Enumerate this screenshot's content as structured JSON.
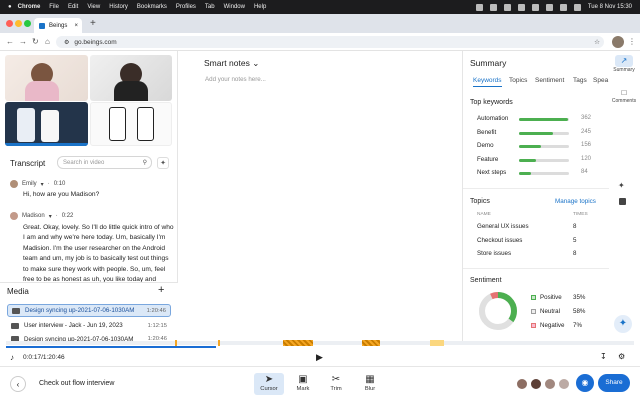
{
  "menubar": {
    "app": "Chrome",
    "items": [
      "File",
      "Edit",
      "View",
      "History",
      "Bookmarks",
      "Profiles",
      "Tab",
      "Window",
      "Help"
    ],
    "clock": "Tue 8 Nov 15:30"
  },
  "browser": {
    "tab_title": "Beings",
    "url": "go.beings.com"
  },
  "transcript": {
    "title": "Transcript",
    "search_placeholder": "Search in video",
    "entries": [
      {
        "speaker": "Emily",
        "time": "0:10",
        "lines": [
          "Hi, how are you Madison?"
        ]
      },
      {
        "speaker": "Madison",
        "time": "0:22",
        "lines": [
          "Great. Okay, lovely. So I'll do little quick intro of who",
          "I am and why we're here today. Um, basically I'm",
          "Madision. I'm the user researcher on the Android",
          "team and um, my job is to basically test out things",
          "to make sure they work with people. So, um, feel",
          "free to be as honest as uh, you like today and"
        ]
      }
    ]
  },
  "media": {
    "title": "Media",
    "items": [
      {
        "label": "Design syncing up-2021-07-06-1030AM",
        "duration": "1:20:46",
        "selected": true
      },
      {
        "label": "User interview - Jack - Jun 19, 2023",
        "duration": "1:12:15",
        "selected": false
      },
      {
        "label": "Design syncing up-2021-07-06-1030AM",
        "duration": "1:20:46",
        "selected": false
      }
    ]
  },
  "notes": {
    "title": "Smart notes",
    "placeholder": "Add your notes here..."
  },
  "summary": {
    "title": "Summary",
    "tabs": [
      "Keywords",
      "Topics",
      "Sentiment",
      "Tags",
      "Spea"
    ],
    "keywords_title": "Top keywords",
    "keywords": [
      {
        "label": "Automation",
        "count": 362,
        "fraction": 0.98
      },
      {
        "label": "Benefit",
        "count": 245,
        "fraction": 0.68
      },
      {
        "label": "Demo",
        "count": 156,
        "fraction": 0.43
      },
      {
        "label": "Feature",
        "count": 120,
        "fraction": 0.33
      },
      {
        "label": "Next steps",
        "count": 84,
        "fraction": 0.23
      }
    ],
    "topics_title": "Topics",
    "manage_topics": "Manage topics",
    "topics_col_name": "NAME",
    "topics_col_times": "TIMES",
    "topics": [
      {
        "name": "General UX issues",
        "times": "8"
      },
      {
        "name": "Checkout issues",
        "times": "5"
      },
      {
        "name": "Store issues",
        "times": "8"
      }
    ],
    "sentiment_title": "Sentiment",
    "sentiment": [
      {
        "label": "Positive",
        "value": "35%",
        "pct": 35,
        "color": "#4caf50"
      },
      {
        "label": "Neutral",
        "value": "58%",
        "pct": 58,
        "color": "#bdbdbd"
      },
      {
        "label": "Negative",
        "value": "7%",
        "pct": 7,
        "color": "#e57373"
      }
    ]
  },
  "rail": {
    "summary": "Summary",
    "comments": "Comments"
  },
  "player": {
    "time": "0:0:17/1:20:46",
    "progress": 0.335
  },
  "bottombar": {
    "back_title": "Check out flow interview",
    "tools": [
      "Cursor",
      "Mark",
      "Trim",
      "Blur"
    ],
    "share": "Share"
  },
  "colors": {
    "accent": "#1a73c8",
    "positive": "#4caf50",
    "timeline_mark": "#f5a623"
  }
}
